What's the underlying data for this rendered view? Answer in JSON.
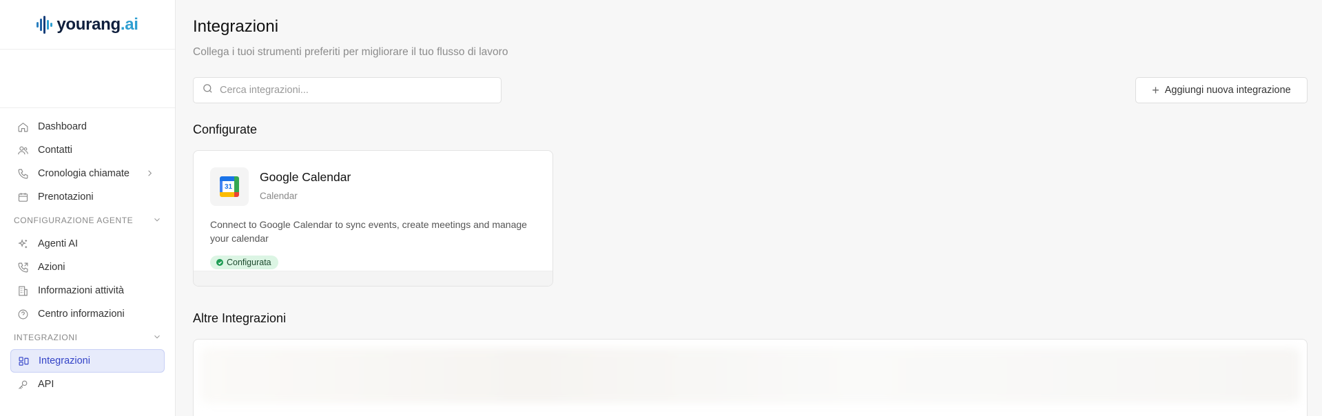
{
  "brand": {
    "name_main": "yourang",
    "name_suffix": ".ai",
    "accent": "#2f9fd1",
    "dark": "#0f1f3d"
  },
  "sidebar": {
    "items_top": [
      {
        "label": "Dashboard",
        "icon": "home-icon"
      },
      {
        "label": "Contatti",
        "icon": "users-icon"
      },
      {
        "label": "Cronologia chiamate",
        "icon": "phone-icon",
        "has_chevron": true
      },
      {
        "label": "Prenotazioni",
        "icon": "calendar-icon"
      }
    ],
    "section_agent": {
      "title": "CONFIGURAZIONE AGENTE",
      "items": [
        {
          "label": "Agenti AI",
          "icon": "sparkles-icon"
        },
        {
          "label": "Azioni",
          "icon": "phone-outgoing-icon"
        },
        {
          "label": "Informazioni attività",
          "icon": "building-icon"
        },
        {
          "label": "Centro informazioni",
          "icon": "help-circle-icon"
        }
      ]
    },
    "section_integrations": {
      "title": "INTEGRAZIONI",
      "items": [
        {
          "label": "Integrazioni",
          "icon": "layout-icon",
          "active": true
        },
        {
          "label": "API",
          "icon": "key-icon"
        }
      ]
    }
  },
  "main": {
    "title": "Integrazioni",
    "subtitle": "Collega i tuoi strumenti preferiti per migliorare il tuo flusso di lavoro",
    "search": {
      "placeholder": "Cerca integrazioni..."
    },
    "add_button": {
      "label": "Aggiungi nuova integrazione"
    },
    "configured": {
      "heading": "Configurate",
      "cards": [
        {
          "title": "Google Calendar",
          "category": "Calendar",
          "icon_text": "31",
          "description": "Connect to Google Calendar to sync events, create meetings and manage your calendar",
          "status": "Configurata",
          "status_color": "#1f9d55"
        }
      ]
    },
    "others": {
      "heading": "Altre Integrazioni"
    }
  }
}
